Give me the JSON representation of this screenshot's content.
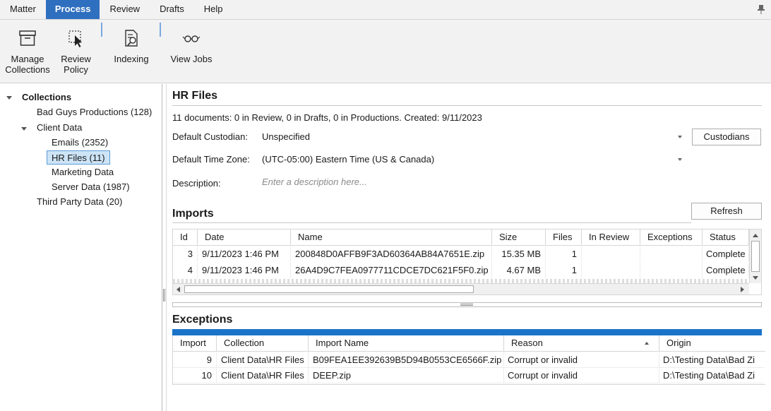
{
  "menu": {
    "tabs": [
      "Matter",
      "Process",
      "Review",
      "Drafts",
      "Help"
    ],
    "active": "Process"
  },
  "ribbon": {
    "manage_collections": [
      "Manage",
      "Collections"
    ],
    "review_policy": [
      "Review",
      "Policy"
    ],
    "indexing": "Indexing",
    "view_jobs": "View Jobs"
  },
  "tree": {
    "root": "Collections",
    "items": [
      {
        "label": "Bad Guys Productions (128)"
      },
      {
        "label": "Client Data"
      },
      {
        "label": "Emails (2352)"
      },
      {
        "label": "HR Files (11)"
      },
      {
        "label": "Marketing Data"
      },
      {
        "label": "Server Data (1987)"
      },
      {
        "label": "Third Party Data (20)"
      }
    ],
    "selected": "HR Files (11)"
  },
  "detail": {
    "title": "HR Files",
    "summary": "11 documents: 0 in Review, 0 in Drafts, 0 in Productions. Created: 9/11/2023",
    "custodian_label": "Default Custodian:",
    "custodian_value": "Unspecified",
    "custodians_button": "Custodians",
    "timezone_label": "Default Time Zone:",
    "timezone_value": "(UTC-05:00) Eastern Time (US & Canada)",
    "description_label": "Description:",
    "description_placeholder": "Enter a description here..."
  },
  "imports": {
    "title": "Imports",
    "refresh_button": "Refresh",
    "columns": [
      "Id",
      "Date",
      "Name",
      "Size",
      "Files",
      "In Review",
      "Exceptions",
      "Status"
    ],
    "rows": [
      {
        "id": "3",
        "date": "9/11/2023 1:46 PM",
        "name": "200848D0AFFB9F3AD60364AB84A7651E.zip",
        "size": "15.35 MB",
        "files": "1",
        "in_review": "",
        "exceptions": "",
        "status": "Complete"
      },
      {
        "id": "4",
        "date": "9/11/2023 1:46 PM",
        "name": "26A4D9C7FEA0977711CDCE7DC621F5F0.zip",
        "size": "4.67 MB",
        "files": "1",
        "in_review": "",
        "exceptions": "",
        "status": "Complete"
      }
    ]
  },
  "exceptions": {
    "title": "Exceptions",
    "columns": [
      "Import",
      "Collection",
      "Import Name",
      "Reason",
      "Origin"
    ],
    "rows": [
      {
        "import": "9",
        "collection": "Client Data\\HR Files",
        "import_name": "B09FEA1EE392639B5D94B0553CE6566F.zip",
        "reason": "Corrupt or invalid",
        "origin": "D:\\Testing Data\\Bad Zi"
      },
      {
        "import": "10",
        "collection": "Client Data\\HR Files",
        "import_name": "DEEP.zip",
        "reason": "Corrupt or invalid",
        "origin": "D:\\Testing Data\\Bad Zi"
      }
    ]
  },
  "colors": {
    "active_tab": "#2f6fbf",
    "progress_bar": "#1a73c9",
    "selection": "#cde4f7"
  }
}
